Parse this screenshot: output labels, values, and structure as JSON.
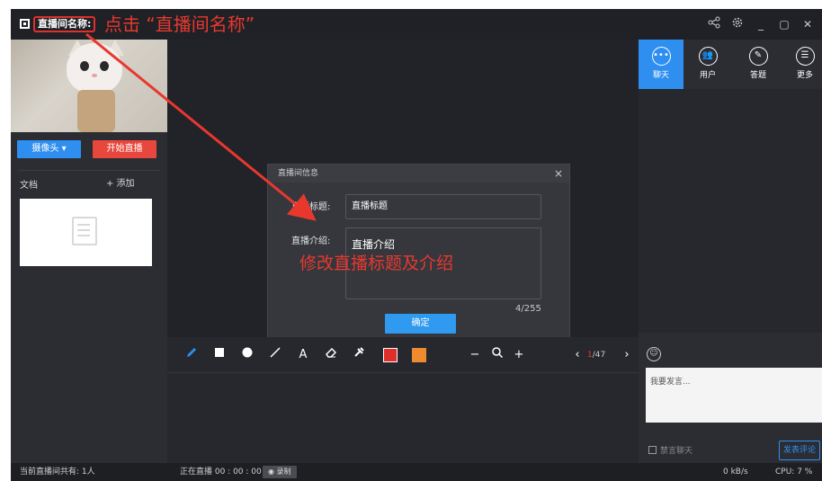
{
  "titlebar": {
    "room_name": "直播间名称:",
    "annotation": "点击 “直播间名称”",
    "controls": [
      "share-icon",
      "settings-icon",
      "minimize-icon",
      "maximize-icon",
      "close-icon"
    ]
  },
  "left": {
    "camera_button": "摄像头 ▾",
    "start_live_button": "开始直播",
    "docs_label": "文档",
    "add_label": "+ 添加"
  },
  "dialog": {
    "title": "直播间信息",
    "close": "×",
    "title_label": "直播标题:",
    "title_value": "直播标题",
    "intro_label": "直播介绍:",
    "intro_value": "直播介绍",
    "char_count": "4/255",
    "ok_button": "确定"
  },
  "annotation_edit": "修改直播标题及介绍",
  "toolbar": {
    "tools": [
      "pencil-icon",
      "rectangle-icon",
      "circle-icon",
      "line-icon",
      "text-icon",
      "eraser-icon",
      "clear-icon"
    ],
    "text_tool": "A",
    "zoom_out": "−",
    "zoom_in": "+",
    "page_prev": "‹",
    "page_next": "›",
    "page_current": "1",
    "page_total": "/47",
    "colors": {
      "red": "#e02f2a",
      "orange": "#f08a30"
    }
  },
  "right": {
    "tabs": [
      {
        "label": "聊天",
        "icon": "chat-icon"
      },
      {
        "label": "用户",
        "icon": "users-icon"
      },
      {
        "label": "答题",
        "icon": "pen-icon"
      },
      {
        "label": "更多",
        "icon": "more-icon"
      }
    ],
    "message_placeholder": "我要发言...",
    "mute_label": "禁言聊天",
    "send_button": "发表评论"
  },
  "status": {
    "count": "当前直播间共有: 1人",
    "live_time": "正在直播 00 : 00 : 00",
    "record": "录制",
    "speed": "0 kB/s",
    "cpu": "CPU: 7 %"
  },
  "colors": {
    "accent": "#2f8ff0",
    "danger": "#e8473e",
    "annotation": "#e8382e"
  }
}
